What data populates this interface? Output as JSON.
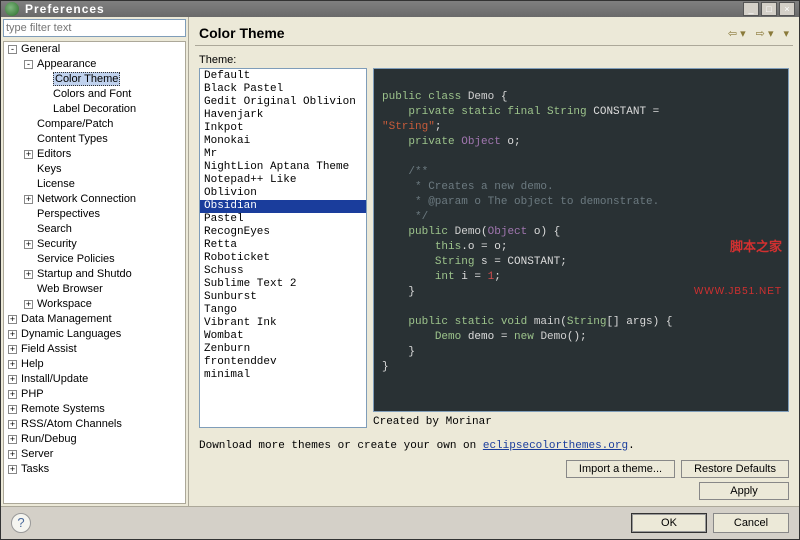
{
  "window": {
    "title": "Preferences"
  },
  "filter": {
    "placeholder": "type filter text"
  },
  "tree": [
    {
      "label": "General",
      "depth": 0,
      "tog": "-",
      "children": [
        {
          "label": "Appearance",
          "depth": 1,
          "tog": "-",
          "children": [
            {
              "label": "Color Theme",
              "depth": 2,
              "sel": true
            },
            {
              "label": "Colors and Font",
              "depth": 2
            },
            {
              "label": "Label Decoration",
              "depth": 2
            }
          ]
        },
        {
          "label": "Compare/Patch",
          "depth": 1
        },
        {
          "label": "Content Types",
          "depth": 1
        },
        {
          "label": "Editors",
          "depth": 1,
          "tog": "+"
        },
        {
          "label": "Keys",
          "depth": 1
        },
        {
          "label": "License",
          "depth": 1
        },
        {
          "label": "Network Connection",
          "depth": 1,
          "tog": "+"
        },
        {
          "label": "Perspectives",
          "depth": 1
        },
        {
          "label": "Search",
          "depth": 1
        },
        {
          "label": "Security",
          "depth": 1,
          "tog": "+"
        },
        {
          "label": "Service Policies",
          "depth": 1
        },
        {
          "label": "Startup and Shutdo",
          "depth": 1,
          "tog": "+"
        },
        {
          "label": "Web Browser",
          "depth": 1
        },
        {
          "label": "Workspace",
          "depth": 1,
          "tog": "+"
        }
      ]
    },
    {
      "label": "Data Management",
      "depth": 0,
      "tog": "+"
    },
    {
      "label": "Dynamic Languages",
      "depth": 0,
      "tog": "+"
    },
    {
      "label": "Field Assist",
      "depth": 0,
      "tog": "+"
    },
    {
      "label": "Help",
      "depth": 0,
      "tog": "+"
    },
    {
      "label": "Install/Update",
      "depth": 0,
      "tog": "+"
    },
    {
      "label": "PHP",
      "depth": 0,
      "tog": "+"
    },
    {
      "label": "Remote Systems",
      "depth": 0,
      "tog": "+"
    },
    {
      "label": "RSS/Atom Channels",
      "depth": 0,
      "tog": "+"
    },
    {
      "label": "Run/Debug",
      "depth": 0,
      "tog": "+"
    },
    {
      "label": "Server",
      "depth": 0,
      "tog": "+"
    },
    {
      "label": "Tasks",
      "depth": 0,
      "tog": "+"
    }
  ],
  "page": {
    "title": "Color Theme",
    "theme_label": "Theme:",
    "themes": [
      "Default",
      "Black Pastel",
      "Gedit Original Oblivion",
      "Havenjark",
      "Inkpot",
      "Monokai",
      "Mr",
      "NightLion Aptana Theme",
      "Notepad++ Like",
      "Oblivion",
      "Obsidian",
      "Pastel",
      "RecognEyes",
      "Retta",
      "Roboticket",
      "Schuss",
      "Sublime Text 2",
      "Sunburst",
      "Tango",
      "Vibrant Ink",
      "Wombat",
      "Zenburn",
      "frontenddev",
      "minimal"
    ],
    "selected_theme": "Obsidian",
    "created_by": "Created by Morinar",
    "download_text": "Download more themes or create your own on ",
    "download_link": "eclipsecolorthemes.org",
    "buttons": {
      "import": "Import a theme...",
      "restore": "Restore Defaults",
      "apply": "Apply",
      "ok": "OK",
      "cancel": "Cancel"
    }
  },
  "watermark": {
    "line1": "脚本之家",
    "line2": "WWW.JB51.NET"
  },
  "code": {
    "l1a": "public class ",
    "l1b": "Demo",
    "l1c": " {",
    "l2a": "private static final ",
    "l2b": "String",
    "l2c": " CONSTANT = ",
    "l3": "\"String\"",
    "l3b": ";",
    "l4a": "private ",
    "l4b": "Object",
    "l4c": " o;",
    "c1": "/**",
    "c2": " * Creates a new demo.",
    "c3": " * @param",
    "c3b": " o The object to demonstrate.",
    "c4": " */",
    "l5a": "public ",
    "l5b": "Demo",
    "l5c": "(",
    "l5d": "Object",
    "l5e": " o) {",
    "l6a": "this",
    ".l6b": ".o = o;",
    "l7a": "String",
    "l7b": " s = CONSTANT;",
    "l8a": "int",
    "l8b": " i = ",
    "l8c": "1",
    "l8d": ";",
    "l9": "}",
    "l10a": "public static void ",
    "l10b": "main",
    "l10c": "(",
    "l10d": "String",
    "l10e": "[] args) {",
    "l11a": "Demo",
    "l11b": " demo = ",
    "l11c": "new ",
    "l11d": "Demo",
    "l11e": "();",
    "l12": "}",
    "l13": "}"
  }
}
